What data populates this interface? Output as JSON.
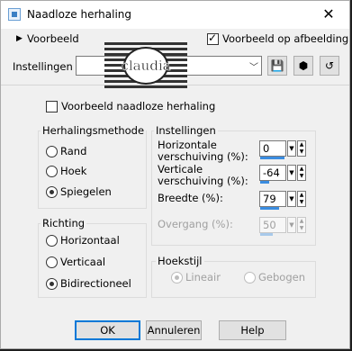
{
  "window": {
    "title": "Naadloze herhaling",
    "close_glyph": "✕"
  },
  "preview": {
    "toggle_label": "Voorbeeld",
    "checkbox_label": "Voorbeeld op afbeelding",
    "checkbox_checked": true
  },
  "presets": {
    "label": "Instellingen",
    "value": "",
    "watermark": "claudia"
  },
  "seamless_checkbox": {
    "label": "Voorbeeld naadloze herhaling",
    "checked": false
  },
  "method": {
    "title": "Herhalingsmethode",
    "options": [
      "Rand",
      "Hoek",
      "Spiegelen"
    ],
    "selected": "Spiegelen"
  },
  "direction": {
    "title": "Richting",
    "options": [
      "Horizontaal",
      "Verticaal",
      "Bidirectioneel"
    ],
    "selected": "Bidirectioneel"
  },
  "settings": {
    "title": "Instellingen",
    "horizontal_label": "Horizontale verschuiving (%):",
    "horizontal_value": "0",
    "vertical_label": "Verticale verschuiving (%):",
    "vertical_value": "-64",
    "width_label": "Breedte (%):",
    "width_value": "79",
    "transition_label": "Overgang (%):",
    "transition_value": "50"
  },
  "corner": {
    "title": "Hoekstijl",
    "options": [
      "Lineair",
      "Gebogen"
    ],
    "selected": "Lineair",
    "disabled": true
  },
  "buttons": {
    "ok": "OK",
    "cancel": "Annuleren",
    "help": "Help"
  }
}
